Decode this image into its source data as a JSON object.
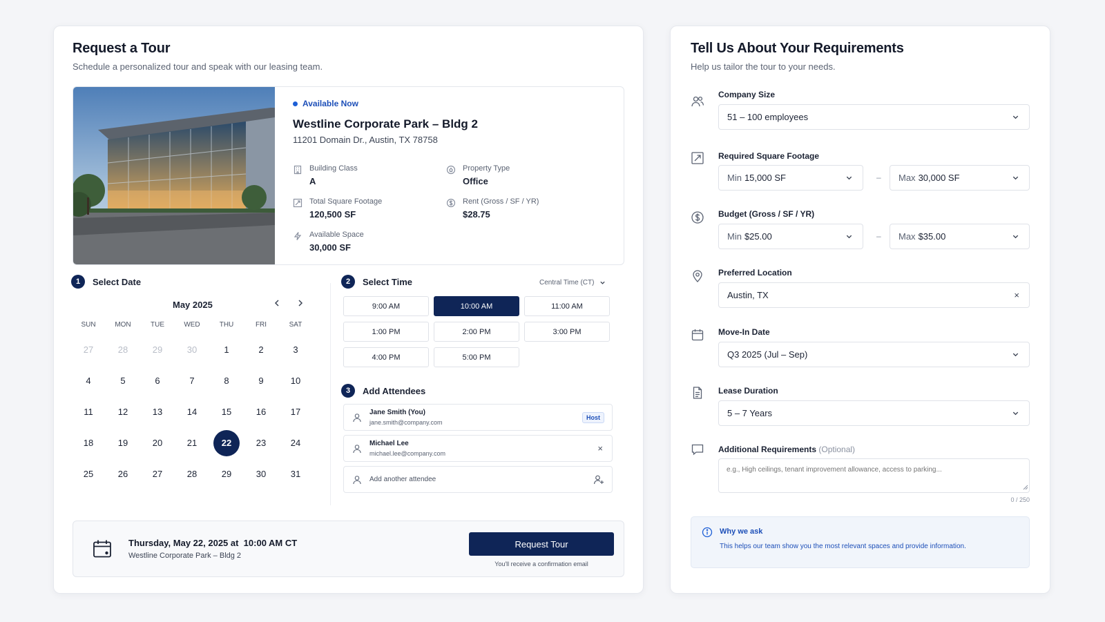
{
  "tour": {
    "title": "Request a Tour",
    "subtitle": "Schedule a personalized tour and speak with our leasing team."
  },
  "property": {
    "badge": "Available Now",
    "name": "Westline Corporate Park – Bldg 2",
    "address": "11201 Domain Dr., Austin, TX 78758",
    "specs": [
      {
        "label": "Building Class",
        "value": "A",
        "icon": "building-icon"
      },
      {
        "label": "Property Type",
        "value": "Office",
        "icon": "property-type-icon"
      },
      {
        "label": "Total Square Footage",
        "value": "120,500 SF",
        "icon": "square-footage-icon"
      },
      {
        "label": "Rent (Gross / SF / YR)",
        "value": "$28.75",
        "icon": "dollar-icon"
      },
      {
        "label": "Available Space",
        "value": "30,000 SF",
        "icon": "lightning-icon"
      }
    ]
  },
  "steps": {
    "date": {
      "num": "1",
      "label": "Select Date"
    },
    "time": {
      "num": "2",
      "label": "Select Time"
    },
    "attendees": {
      "num": "3",
      "label": "Add Attendees"
    }
  },
  "calendar": {
    "month": "May 2025",
    "weekdays": [
      "SUN",
      "MON",
      "TUE",
      "WED",
      "THU",
      "FRI",
      "SAT"
    ],
    "weeks": [
      [
        "27",
        "28",
        "29",
        "30",
        "1",
        "2",
        "3"
      ],
      [
        "4",
        "5",
        "6",
        "7",
        "8",
        "9",
        "10"
      ],
      [
        "11",
        "12",
        "13",
        "14",
        "15",
        "16",
        "17"
      ],
      [
        "18",
        "19",
        "20",
        "21",
        "22",
        "23",
        "24"
      ],
      [
        "25",
        "26",
        "27",
        "28",
        "29",
        "30",
        "31"
      ]
    ],
    "muted_days_first_week": 4,
    "selected": "22"
  },
  "time": {
    "timezone": "Central Time (CT)",
    "slots": [
      "9:00 AM",
      "10:00 AM",
      "11:00 AM",
      "1:00 PM",
      "2:00 PM",
      "3:00 PM",
      "4:00 PM",
      "5:00 PM"
    ],
    "selected": "10:00 AM"
  },
  "attendees": {
    "list": [
      {
        "name": "Jane Smith (You)",
        "email": "jane.smith@company.com",
        "badge": "Host"
      },
      {
        "name": "Michael Lee",
        "email": "michael.lee@company.com",
        "remove": "×"
      }
    ],
    "add_placeholder": "Add another attendee"
  },
  "summary": {
    "datetime": "Thursday, May 22, 2025 at  10:00 AM CT",
    "place": "Westline Corporate Park – Bldg 2",
    "button": "Request Tour",
    "note": "You'll receive a confirmation email"
  },
  "requirements": {
    "title": "Tell Us About Your Requirements",
    "subtitle": "Help us tailor the tour to your needs.",
    "company_size": {
      "label": "Company Size",
      "value": "51 – 100 employees"
    },
    "square_footage": {
      "label": "Required Square Footage",
      "min_prefix": "Min",
      "min": "15,000 SF",
      "max_prefix": "Max",
      "max": "30,000 SF",
      "sep": "–"
    },
    "budget": {
      "label": "Budget (Gross / SF / YR)",
      "min_prefix": "Min",
      "min": "$25.00",
      "max_prefix": "Max",
      "max": "$35.00",
      "sep": "–"
    },
    "location": {
      "label": "Preferred Location",
      "value": "Austin, TX",
      "clear": "×"
    },
    "move_in": {
      "label": "Move-In Date",
      "value": "Q3 2025 (Jul – Sep)"
    },
    "lease": {
      "label": "Lease Duration",
      "value": "5 – 7 Years"
    },
    "additional": {
      "label": "Additional Requirements",
      "optional": "(Optional)",
      "placeholder": "e.g., High ceilings, tenant improvement allowance, access to parking...",
      "counter": "0 / 250"
    },
    "why": {
      "title": "Why we ask",
      "text": "This helps our team show you the most relevant spaces and provide information."
    }
  },
  "colors": {
    "primary": "#0f2557",
    "accent": "#1d5fd6",
    "info_bg": "#f1f5fb"
  }
}
